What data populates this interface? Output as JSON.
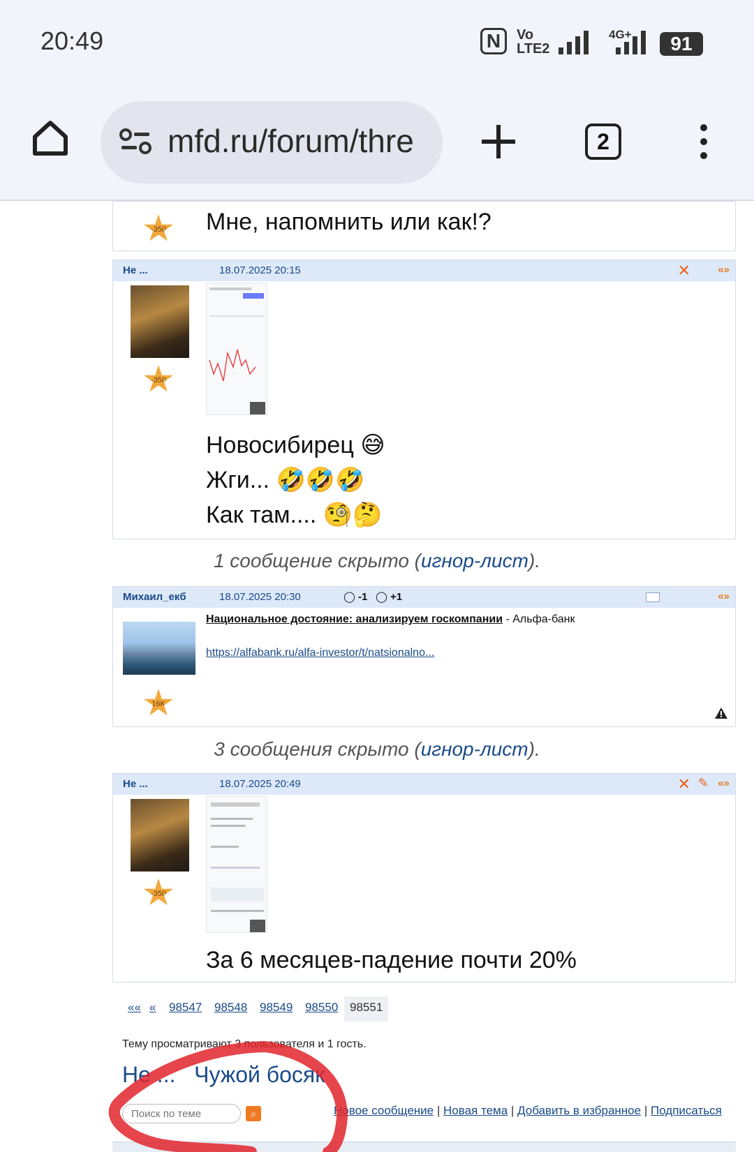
{
  "status_bar": {
    "time": "20:49",
    "volte_label_top": "Vo",
    "volte_label_bottom": "LTE2",
    "net_label": "4G+",
    "battery": "91"
  },
  "browser": {
    "url": "mfd.ru/forum/thre",
    "tab_count": "2"
  },
  "top_post": {
    "text": "Мне, напомнить или как!?",
    "rating": "-350"
  },
  "post1": {
    "author": "Не ...",
    "date": "18.07.2025 20:15",
    "rating": "-350",
    "nav": "«»",
    "lines": [
      "Новосибирец 😅",
      "Жги... 🤣🤣🤣",
      "Как там.... 🧐🤔"
    ]
  },
  "hidden1": {
    "prefix": "1 сообщение скрыто (",
    "link": "игнор-лист",
    "suffix": ")."
  },
  "post2": {
    "author": "Михаил_екб",
    "date": "18.07.2025 20:30",
    "vote_minus": "-1",
    "vote_plus": "+1",
    "nav": "«»",
    "rating": "16K",
    "title": "Национальное достояние: анализируем госкомпании",
    "source": " - Альфа-банк",
    "url": "https://alfabank.ru/alfa-investor/t/natsionalno..."
  },
  "hidden2": {
    "prefix": "3 сообщения скрыто (",
    "link": "игнор-лист",
    "suffix": ")."
  },
  "post3": {
    "author": "Не ...",
    "date": "18.07.2025 20:49",
    "rating": "-350",
    "nav": "«»",
    "text": "За 6 месяцев-падение почти 20%"
  },
  "pager": {
    "first": "««",
    "prev": "«",
    "pages": [
      "98547",
      "98548",
      "98549",
      "98550"
    ],
    "current": "98551"
  },
  "viewers": "Тему просматривают 3 пользователя и 1 гость.",
  "viewer_names": [
    "Не ...",
    "Чужой босяк"
  ],
  "search": {
    "placeholder": "Поиск по теме"
  },
  "footer_links": [
    "Новое сообщение",
    "Новая тема",
    "Добавить в избранное",
    "Подписаться"
  ]
}
